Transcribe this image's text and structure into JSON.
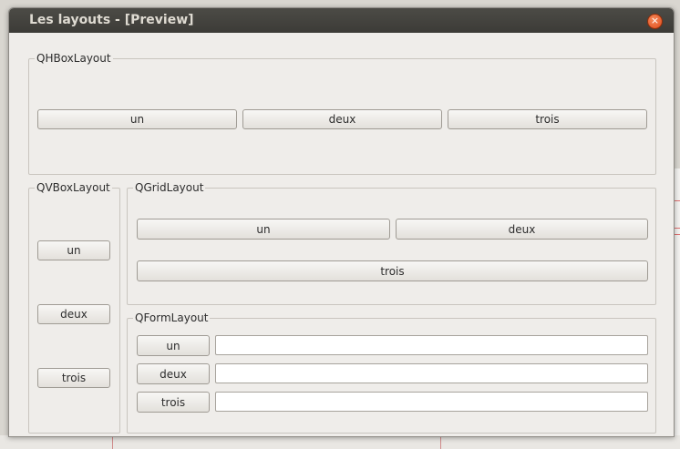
{
  "window": {
    "title": "Les layouts - [Preview]",
    "close_glyph": "×"
  },
  "groups": {
    "hbox": {
      "title": "QHBoxLayout",
      "buttons": [
        "un",
        "deux",
        "trois"
      ]
    },
    "vbox": {
      "title": "QVBoxLayout",
      "buttons": [
        "un",
        "deux",
        "trois"
      ]
    },
    "grid": {
      "title": "QGridLayout",
      "buttons": [
        "un",
        "deux",
        "trois"
      ]
    },
    "form": {
      "title": "QFormLayout",
      "rows": [
        {
          "label": "un",
          "value": ""
        },
        {
          "label": "deux",
          "value": ""
        },
        {
          "label": "trois",
          "value": ""
        }
      ]
    }
  },
  "colors": {
    "titlebar": "#3c3b37",
    "close_button": "#df4a1a",
    "background": "#efedea"
  }
}
